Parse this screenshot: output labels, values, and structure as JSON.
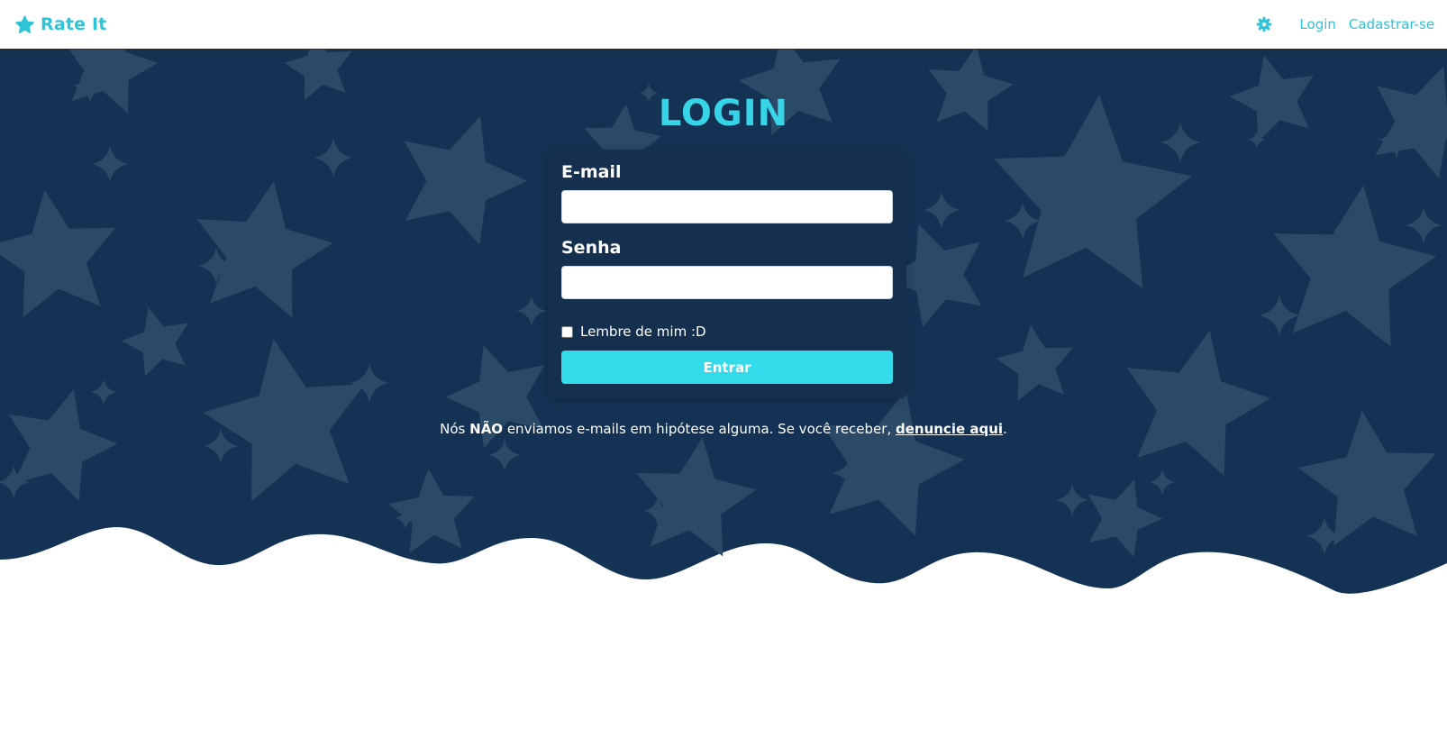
{
  "navbar": {
    "brand": "Rate It",
    "brand_icon": "star-icon",
    "settings_icon": "gear-icon",
    "links": [
      "Login",
      "Cadastrar-se"
    ]
  },
  "login": {
    "title": "LOGIN",
    "email_label": "E-mail",
    "email_value": "",
    "password_label": "Senha",
    "password_value": "",
    "remember_label": "Lembre de mim :D",
    "remember_checked": false,
    "submit_label": "Entrar"
  },
  "notice": {
    "text_before": "Nós ",
    "emphasis": "NÃO",
    "text_middle": " enviamos e-mails em hipótese alguma. Se você receber, ",
    "link": "denuncie aqui",
    "text_after": "."
  },
  "colors": {
    "accent": "#2ec4d8",
    "button": "#33dbea",
    "hero_background": "#143354",
    "star_pattern": "#2b4a68",
    "card": "#15304f"
  }
}
